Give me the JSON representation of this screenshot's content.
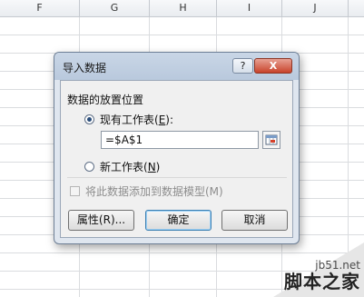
{
  "spreadsheet": {
    "columns": [
      "F",
      "G",
      "H",
      "I",
      "J"
    ]
  },
  "dialog": {
    "title": "导入数据",
    "help_button": "?",
    "close_button": "X",
    "section_label": "数据的放置位置",
    "existing_sheet": {
      "label_text": "现有工作表(",
      "hotkey": "E",
      "label_tail": "):",
      "checked": true
    },
    "reference_value": "=$A$1",
    "new_sheet": {
      "label_text": "新工作表(",
      "hotkey": "N",
      "label_tail": ")",
      "checked": false
    },
    "data_model_checkbox": {
      "label": "将此数据添加到数据模型(M)",
      "checked": false,
      "enabled": false
    },
    "buttons": {
      "properties": "属性(R)...",
      "ok": "确定",
      "cancel": "取消"
    }
  },
  "watermark": {
    "url": "jb51.net",
    "text": "脚本之家"
  }
}
